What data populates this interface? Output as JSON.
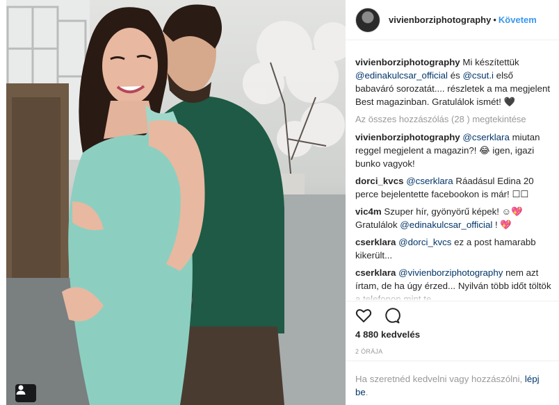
{
  "post": {
    "author": "vivienborziphotography",
    "dot": "•",
    "follow_label": "Követem",
    "caption": {
      "user": "vivienborziphotography",
      "parts": [
        {
          "t": " Mi készítettük "
        },
        {
          "m": "@edinakulcsar_official"
        },
        {
          "t": " és "
        },
        {
          "m": "@csut.i"
        },
        {
          "t": " első babaváró sorozatát.... részletek a ma megjelent Best magazinban. Gratulálok ismét! 🖤"
        }
      ]
    },
    "view_all": "Az összes hozzászólás (28 ) megtekintése",
    "comments": [
      {
        "user": "vivienborziphotography",
        "parts": [
          {
            "m": "@cserklara"
          },
          {
            "t": " miutan reggel megjelent a magazin?! 😂 igen, igazi bunko vagyok!"
          }
        ]
      },
      {
        "user": "dorci_kvcs",
        "parts": [
          {
            "m": "@cserklara"
          },
          {
            "t": " Ráadásul Edina 20 perce bejelentette facebookon is már! ☐☐"
          }
        ]
      },
      {
        "user": "vic4m",
        "parts": [
          {
            "t": "Szuper hír, gyönyörű képek! ☺💖 Gratulálok "
          },
          {
            "m": "@edinakulcsar_official"
          },
          {
            "t": " ! 💖"
          }
        ]
      },
      {
        "user": "cserklara",
        "parts": [
          {
            "m": "@dorci_kvcs"
          },
          {
            "t": " ez a post hamarabb kikerült..."
          }
        ]
      },
      {
        "user": "cserklara",
        "parts": [
          {
            "m": "@vivienborziphotography"
          },
          {
            "t": " nem azt írtam, de ha úgy érzed... Nyilván több időt töltök a telefonon mint te."
          }
        ]
      }
    ],
    "icons": {
      "like": "heart-outline-icon",
      "comment": "comment-bubble-icon",
      "tag": "person-tag-icon"
    },
    "likes": "4 880 kedvelés",
    "time_ago": "2 ÓRÁJA",
    "login_prompt": "Ha szeretnéd kedvelni vagy hozzászólni, ",
    "login_link": "lépj be",
    "login_end": "."
  },
  "colors": {
    "link": "#003569",
    "follow": "#3897f0",
    "muted": "#999999",
    "text": "#262626",
    "sweater": "#1e5a45",
    "dress": "#8ccfc0"
  }
}
